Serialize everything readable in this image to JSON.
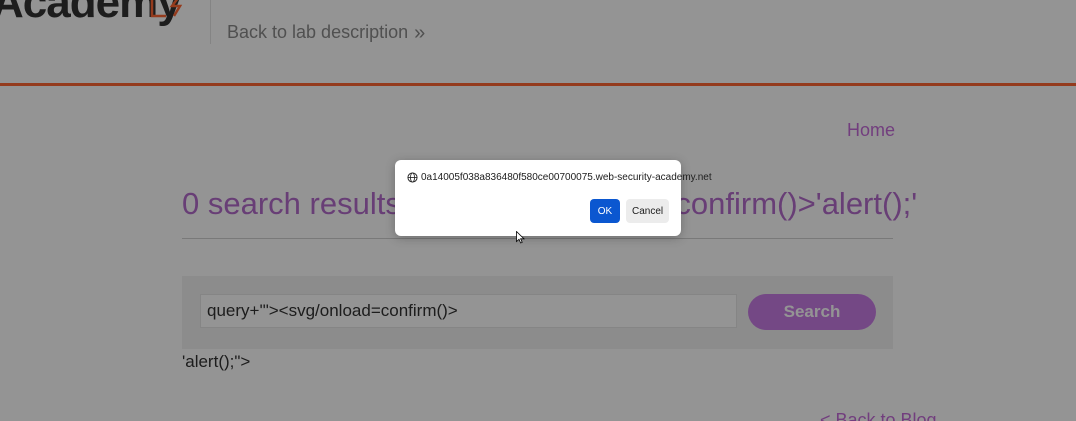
{
  "header": {
    "logo_text": "Academy",
    "back_link": "Back to lab description",
    "back_chevron_icon": "double-chevron-right-icon",
    "accent_color": "#ff6633"
  },
  "nav": {
    "home": "Home"
  },
  "results": {
    "title": "0 search results for '\"><svg/onload=confirm()>'alert();'"
  },
  "search": {
    "value": "query+'\"><svg/onload=confirm()>",
    "button_label": "Search"
  },
  "reflected": {
    "text": "'alert();\">"
  },
  "footer": {
    "back_blog": "< Back to Blog"
  },
  "dialog": {
    "origin": "0a14005f038a836480f580ce00700075.web-security-academy.net",
    "origin_icon": "globe-icon",
    "ok_label": "OK",
    "cancel_label": "Cancel",
    "ok_color": "#0b57d0"
  }
}
